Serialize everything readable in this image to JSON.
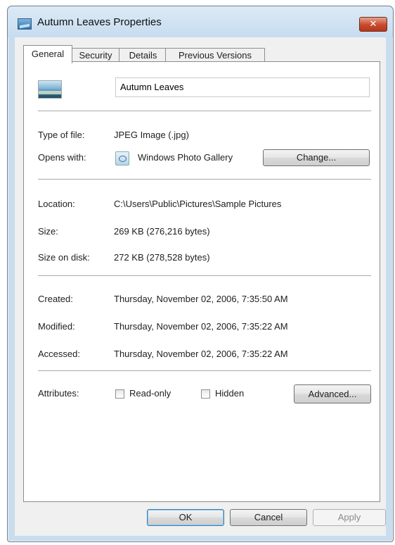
{
  "window": {
    "title": "Autumn Leaves Properties",
    "close_label": "✕"
  },
  "tabs": [
    {
      "label": "General",
      "active": true
    },
    {
      "label": "Security",
      "active": false
    },
    {
      "label": "Details",
      "active": false
    },
    {
      "label": "Previous Versions",
      "active": false
    }
  ],
  "general": {
    "file_name": "Autumn Leaves",
    "type_label": "Type of file:",
    "type_value": "JPEG Image (.jpg)",
    "opens_label": "Opens with:",
    "opens_value": "Windows Photo Gallery",
    "change_button": "Change...",
    "location_label": "Location:",
    "location_value": "C:\\Users\\Public\\Pictures\\Sample Pictures",
    "size_label": "Size:",
    "size_value": "269 KB (276,216 bytes)",
    "size_on_disk_label": "Size on disk:",
    "size_on_disk_value": "272 KB (278,528 bytes)",
    "created_label": "Created:",
    "created_value": "Thursday, November 02, 2006, 7:35:50 AM",
    "modified_label": "Modified:",
    "modified_value": "Thursday, November 02, 2006, 7:35:22 AM",
    "accessed_label": "Accessed:",
    "accessed_value": "Thursday, November 02, 2006, 7:35:22 AM",
    "attributes_label": "Attributes:",
    "readonly_label": "Read-only",
    "readonly_checked": false,
    "hidden_label": "Hidden",
    "hidden_checked": false,
    "advanced_button": "Advanced..."
  },
  "footer": {
    "ok": "OK",
    "cancel": "Cancel",
    "apply": "Apply"
  }
}
